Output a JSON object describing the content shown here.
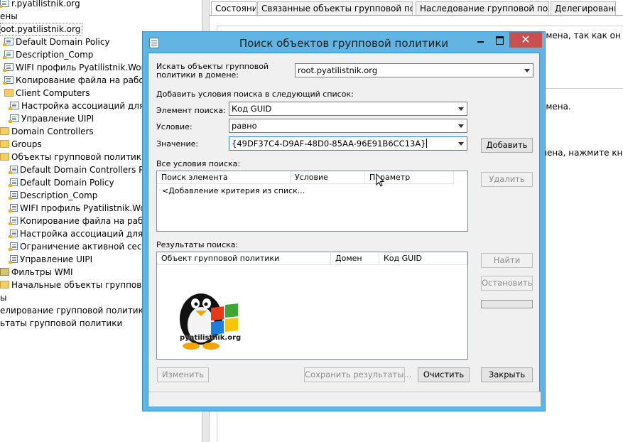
{
  "tree": {
    "items": [
      {
        "label": "r.pyatilistnik.org",
        "icon": "folder-icon",
        "type": "none"
      },
      {
        "label": "ены",
        "icon": "",
        "type": "none"
      },
      {
        "label": "oot.pyatilistnik.org",
        "icon": "",
        "type": "none"
      },
      {
        "label": "Default Domain Policy",
        "icon": "gpo-link-icon",
        "type": "gpo"
      },
      {
        "label": "Description_Comp",
        "icon": "gpo-link-icon",
        "type": "gpo"
      },
      {
        "label": "WIFI профиль Pyatilistnik.Work",
        "icon": "gpo-link-icon",
        "type": "gpo"
      },
      {
        "label": "Копирование файла на рабочий ст",
        "icon": "gpo-link-icon",
        "type": "gpo"
      },
      {
        "label": "Client Computers",
        "icon": "folder-icon",
        "type": "folder"
      },
      {
        "label": "Настройка ассоциаций для офи",
        "icon": "gpo-link-icon",
        "type": "gpo"
      },
      {
        "label": "Управление UIPI",
        "icon": "gpo-link-icon",
        "type": "gpo"
      },
      {
        "label": "Domain Controllers",
        "icon": "folder-icon",
        "type": "folder"
      },
      {
        "label": "Groups",
        "icon": "folder-icon",
        "type": "folder"
      },
      {
        "label": "Объекты групповой политики",
        "icon": "folder-icon",
        "type": "folder"
      },
      {
        "label": "Default Domain Controllers Polic",
        "icon": "gpo-icon",
        "type": "gpo"
      },
      {
        "label": "Default Domain Policy",
        "icon": "gpo-icon",
        "type": "gpo"
      },
      {
        "label": "Description_Comp",
        "icon": "gpo-icon",
        "type": "gpo"
      },
      {
        "label": "WIFI профиль Pyatilistnik.Work",
        "icon": "gpo-icon",
        "type": "gpo"
      },
      {
        "label": "Копирование файла на рабочи",
        "icon": "gpo-icon",
        "type": "gpo"
      },
      {
        "label": "Настройка ассоциаций для оф",
        "icon": "gpo-icon",
        "type": "gpo"
      },
      {
        "label": "Ограничение активной сессии",
        "icon": "gpo-icon",
        "type": "gpo"
      },
      {
        "label": "Управление UIPI",
        "icon": "gpo-icon",
        "type": "gpo"
      },
      {
        "label": "Фильтры WMI",
        "icon": "wmi-filter-icon",
        "type": "wmi"
      },
      {
        "label": "Начальные объекты групповой по",
        "icon": "folder-icon",
        "type": "folder"
      },
      {
        "label": "ы",
        "icon": "",
        "type": "none"
      },
      {
        "label": "елирование групповой политики",
        "icon": "",
        "type": "none"
      },
      {
        "label": "ьтаты групповой политики",
        "icon": "",
        "type": "none"
      }
    ]
  },
  "right_pane": {
    "tabs": [
      {
        "label": "Состояние",
        "active": true
      },
      {
        "label": "Связанные объекты групповой политики",
        "active": false
      },
      {
        "label": "Наследование групповой политики",
        "active": false
      },
      {
        "label": "Делегирование",
        "active": false
      }
    ],
    "frag1": "омена, так как он име",
    "frag2": "омена.",
    "frag3": "мена, нажмите кнопку"
  },
  "dialog": {
    "title": "Поиск объектов групповой политики",
    "close_glyph": "✕",
    "search_in_label": "Искать объекты групповой политики в домене:",
    "domain_value": "root.pyatilistnik.org",
    "add_conditions_label": "Добавить условия поиска в следующий список:",
    "search_item_label": "Элемент поиска:",
    "search_item_value": "Код GUID",
    "condition_label": "Условие:",
    "condition_value": "равно",
    "value_label": "Значение:",
    "value_value": "{49DF37C4-D9AF-48D0-85AA-96E91B6CC13A}",
    "add_button": "Добавить",
    "all_conditions_label": "Все условия поиска:",
    "conditions_columns": [
      "Поиск элемента",
      "Условие",
      "Параметр"
    ],
    "conditions_placeholder": "<Добавление критерия из списк...",
    "remove_button": "Удалить",
    "results_label": "Результаты поиска:",
    "results_columns": [
      "Объект групповой политики",
      "Домен",
      "Код GUID"
    ],
    "find_button": "Найти",
    "stop_button": "Остановить",
    "edit_button": "Изменить",
    "save_button": "Сохранить результаты...",
    "clear_button": "Очистить",
    "close_button": "Закрыть",
    "logo_text": "pyatilistnik.org"
  }
}
